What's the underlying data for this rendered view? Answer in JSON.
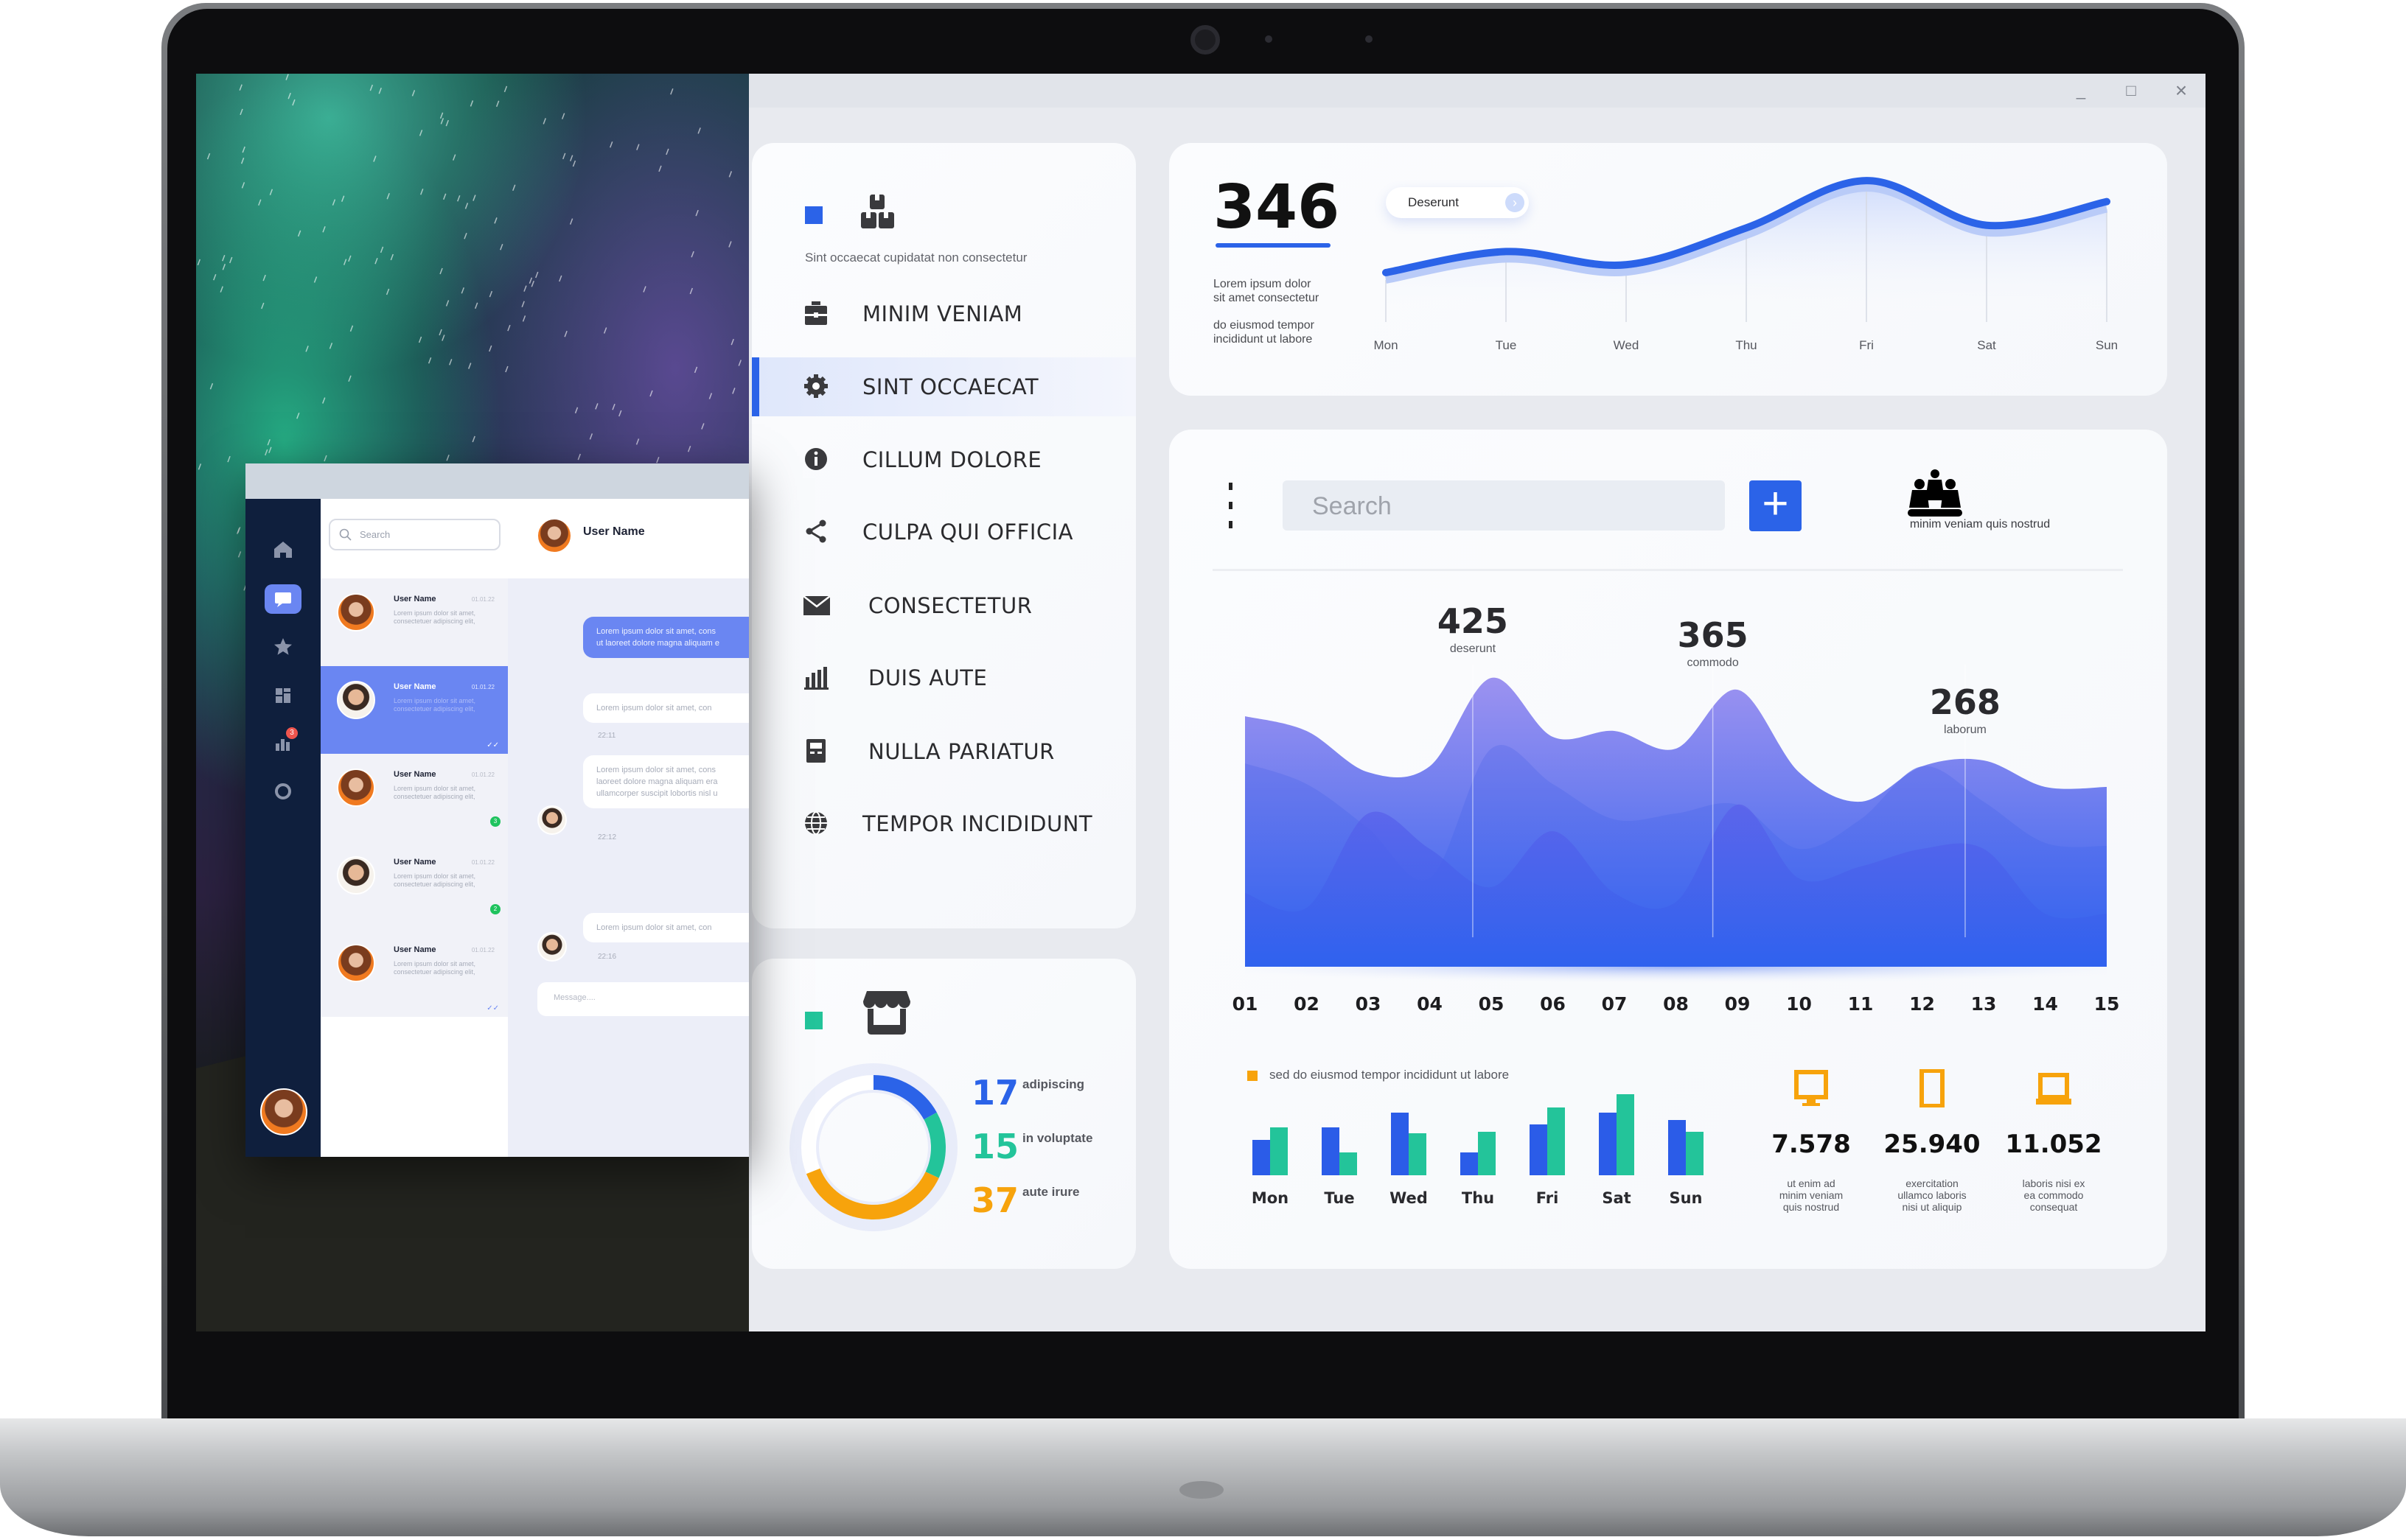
{
  "chat_app": {
    "search_placeholder": "Search",
    "header_user": "User Name",
    "sidebar_icons": [
      "home-icon",
      "chat-icon",
      "star-icon",
      "dashboard-icon",
      "chart-icon",
      "settings-icon"
    ],
    "stats_badge": "3",
    "conversations": [
      {
        "name": "User Name",
        "time": "01.01.22",
        "preview": "Lorem ipsum dolor sit amet, consectetuer adipiscing elit,",
        "status": "",
        "selected": false
      },
      {
        "name": "User Name",
        "time": "01.01.22",
        "preview": "Lorem ipsum dolor sit amet, consectetuer adipiscing elit,",
        "status": "read",
        "selected": true
      },
      {
        "name": "User Name",
        "time": "01.01.22",
        "preview": "Lorem ipsum dolor sit amet, consectetuer adipiscing elit,",
        "status": "3",
        "selected": false
      },
      {
        "name": "User Name",
        "time": "01.01.22",
        "preview": "Lorem ipsum dolor sit amet, consectetuer adipiscing elit,",
        "status": "2",
        "selected": false
      },
      {
        "name": "User Name",
        "time": "01.01.22",
        "preview": "Lorem ipsum dolor sit amet, consectetuer adipiscing elit,",
        "status": "read",
        "selected": false
      }
    ],
    "messages": [
      {
        "text": "Lorem ipsum dolor sit amet, consectetuer adipiscing elit, sed diam nonummy nibh euismod tincidunt ut laoreet dolore magna aliquam erat volutpat.",
        "line1": "Lorem ipsum dolor sit amet, cons",
        "line2": "ut laoreet dolore magna aliquam e",
        "own": true
      },
      {
        "line1": "Lorem ipsum dolor sit amet, con",
        "time": "22:11"
      },
      {
        "line1": "Lorem ipsum dolor sit amet, cons",
        "line2": "laoreet dolore magna aliquam era",
        "line3": "ullamcorper suscipit lobortis nisl u",
        "time": "22:12"
      },
      {
        "line1": "Lorem ipsum dolor sit amet, con",
        "time": "22:16"
      }
    ],
    "message_placeholder": "Message...."
  },
  "window_controls": {
    "minimize": "_",
    "maximize": "□",
    "close": "×"
  },
  "nav": {
    "accent": "#2b63e8",
    "caption": "Sint occaecat cupidatat non consectetur",
    "items": [
      {
        "label": "MINIM VENIAM",
        "icon": "briefcase-icon",
        "selected": false
      },
      {
        "label": "SINT OCCAECAT",
        "icon": "gear-icon",
        "selected": true
      },
      {
        "label": "CILLUM DOLORE",
        "icon": "info-icon",
        "selected": false
      },
      {
        "label": "CULPA QUI OFFICIA",
        "icon": "share-icon",
        "selected": false
      },
      {
        "label": "CONSECTETUR",
        "icon": "mail-icon",
        "selected": false
      },
      {
        "label": "DUIS AUTE",
        "icon": "bar-chart-icon",
        "selected": false
      },
      {
        "label": "NULLA PARIATUR",
        "icon": "document-icon",
        "selected": false
      },
      {
        "label": "TEMPOR INCIDIDUNT",
        "icon": "globe-icon",
        "selected": false
      }
    ]
  },
  "donut": {
    "segments": [
      {
        "value": 17,
        "label": "adipiscing",
        "color": "#2b63e8"
      },
      {
        "value": 15,
        "label": "in voluptate",
        "color": "#23c49a"
      },
      {
        "value": 37,
        "label": "aute irure",
        "color": "#f7a30c"
      }
    ]
  },
  "summary": {
    "value": "346",
    "text1": "Lorem ipsum dolor sit amet consectetur",
    "text1_a": "Lorem ipsum dolor",
    "text1_b": "sit amet consectetur",
    "text2_a": "do eiusmod tempor",
    "text2_b": "incididunt ut labore",
    "pill_label": "Deserunt"
  },
  "main": {
    "search_placeholder": "Search",
    "add_label": "+",
    "group_caption": "minim veniam quis nostrud",
    "legend_label": "sed do eiusmod tempor incididunt ut labore",
    "stats": [
      {
        "icon": "monitor-icon",
        "value": "7.578",
        "caption": [
          "ut enim ad",
          "minim veniam",
          "quis nostrud"
        ]
      },
      {
        "icon": "phone-icon",
        "value": "25.940",
        "caption": [
          "exercitation",
          "ullamco laboris",
          "nisi ut aliquip"
        ]
      },
      {
        "icon": "laptop-icon",
        "value": "11.052",
        "caption": [
          "laboris nisi ex",
          "ea commodo",
          "consequat"
        ]
      }
    ]
  },
  "chart_data": [
    {
      "type": "line",
      "categories": [
        "Mon",
        "Tue",
        "Wed",
        "Thu",
        "Fri",
        "Sat",
        "Sun"
      ],
      "values": [
        30,
        38,
        33,
        47,
        65,
        48,
        57
      ],
      "ylim": [
        0,
        100
      ],
      "grid": "vertical",
      "color": "#2b63e8"
    },
    {
      "type": "area",
      "categories": [
        "01",
        "02",
        "03",
        "04",
        "05",
        "06",
        "07",
        "08",
        "09",
        "10",
        "11",
        "12",
        "13",
        "14",
        "15"
      ],
      "series": [
        {
          "values": [
            85,
            80,
            66,
            68,
            98,
            78,
            80,
            74,
            94,
            66,
            56,
            68,
            70,
            61,
            61
          ],
          "color": "#9c92f0"
        },
        {
          "values": [
            69,
            62,
            47,
            30,
            74,
            62,
            50,
            52,
            55,
            40,
            50,
            68,
            56,
            42,
            41
          ],
          "color": "#6d78ec"
        },
        {
          "values": [
            25,
            20,
            52,
            40,
            27,
            46,
            25,
            22,
            55,
            30,
            34,
            40,
            40,
            18,
            18
          ],
          "color": "#5a60ea"
        }
      ],
      "ylim": [
        0,
        100
      ],
      "annotations": [
        {
          "at": 4.7,
          "value": "425",
          "label": "deserunt"
        },
        {
          "at": 8.6,
          "value": "365",
          "label": "commodo"
        },
        {
          "at": 12.7,
          "value": "268",
          "label": "laborum"
        }
      ]
    },
    {
      "type": "bar",
      "categories": [
        "Mon",
        "Tue",
        "Wed",
        "Thu",
        "Fri",
        "Sat",
        "Sun"
      ],
      "series": [
        {
          "values": [
            48,
            65,
            85,
            31,
            69,
            85,
            75
          ],
          "color": "#2b5ce8"
        },
        {
          "values": [
            65,
            31,
            57,
            59,
            92,
            110,
            59
          ],
          "color": "#23c49a"
        }
      ],
      "ylim": [
        0,
        110
      ],
      "legend": "top-left"
    }
  ]
}
